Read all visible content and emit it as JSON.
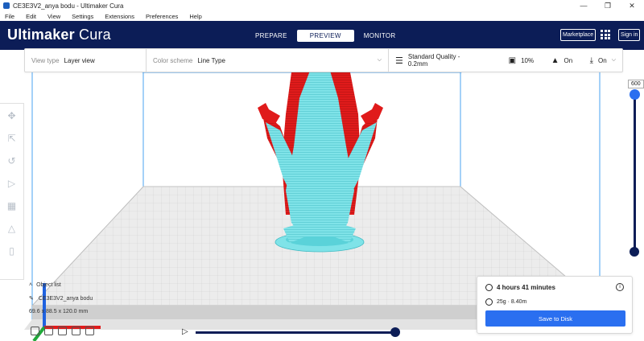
{
  "window": {
    "title": "CE3E3V2_anya bodu - Ultimaker Cura",
    "minimize": "—",
    "maximize": "❐",
    "close": "✕"
  },
  "menu": [
    "File",
    "Edit",
    "View",
    "Settings",
    "Extensions",
    "Preferences",
    "Help"
  ],
  "header": {
    "brand_bold": "Ultimaker",
    "brand_light": " Cura",
    "stages": [
      "PREPARE",
      "PREVIEW",
      "MONITOR"
    ],
    "active_stage": "PREVIEW",
    "marketplace": "Marketplace",
    "signin": "Sign in"
  },
  "toolbar": {
    "view_type_label": "View type",
    "view_type_value": "Layer view",
    "color_scheme_label": "Color scheme",
    "color_scheme_value": "Line Type",
    "quality": "Standard Quality - 0.2mm",
    "infill": "10%",
    "support": "On",
    "adhesion": "On"
  },
  "object_list": {
    "header": "Object list",
    "item": "CE3E3V2_anya bodu",
    "dims": "69.6 x 88.5 x 120.0 mm"
  },
  "layer_slider": {
    "max_layer": "600"
  },
  "print_info": {
    "time": "4 hours 41 minutes",
    "material": "25g · 8.40m",
    "save": "Save to Disk"
  },
  "colors": {
    "header_bg": "#0c1d57",
    "accent": "#2a6ff0",
    "model_red": "#e01b1b",
    "model_cyan": "#7fe3e8"
  }
}
